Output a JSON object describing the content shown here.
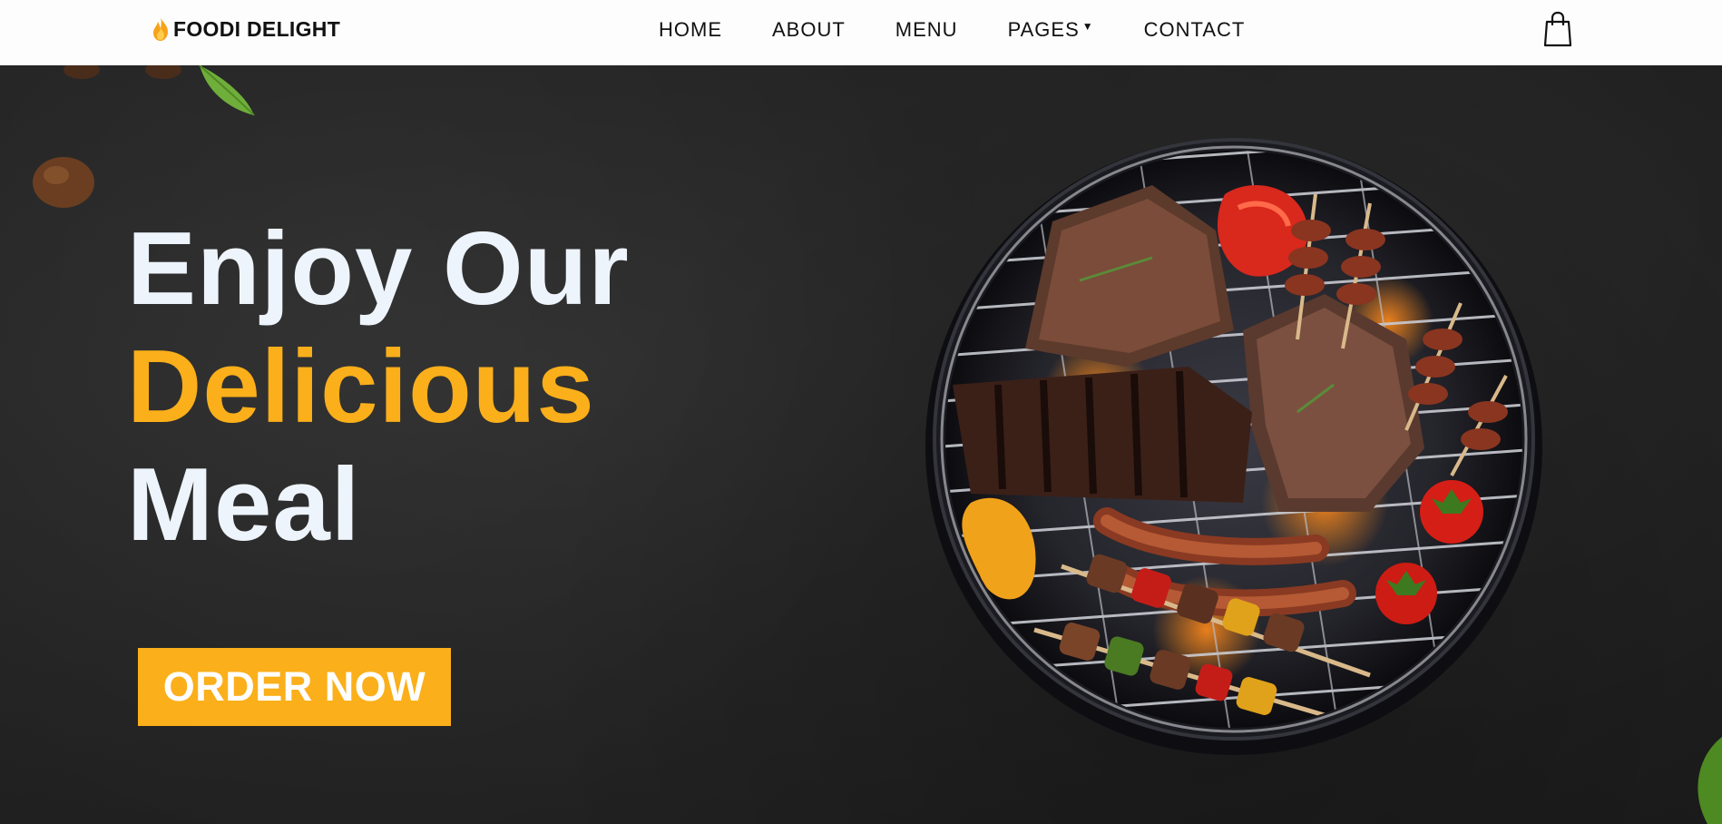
{
  "brand": {
    "name": "FOODI DELIGHT",
    "icon": "flame-icon"
  },
  "nav": {
    "items": [
      {
        "label": "HOME"
      },
      {
        "label": "ABOUT"
      },
      {
        "label": "MENU"
      },
      {
        "label": "PAGES",
        "has_dropdown": true
      },
      {
        "label": "CONTACT"
      }
    ],
    "cart_icon": "shopping-bag-icon"
  },
  "hero": {
    "line1": "Enjoy Our",
    "line2": "Delicious",
    "line3": "Meal",
    "cta_label": "ORDER NOW",
    "image": "barbecue-grill-with-meats"
  },
  "colors": {
    "accent": "#fbaf1a",
    "nav_bg": "#fdfdfd",
    "hero_bg": "#232323",
    "headline": "#eef4fb"
  }
}
